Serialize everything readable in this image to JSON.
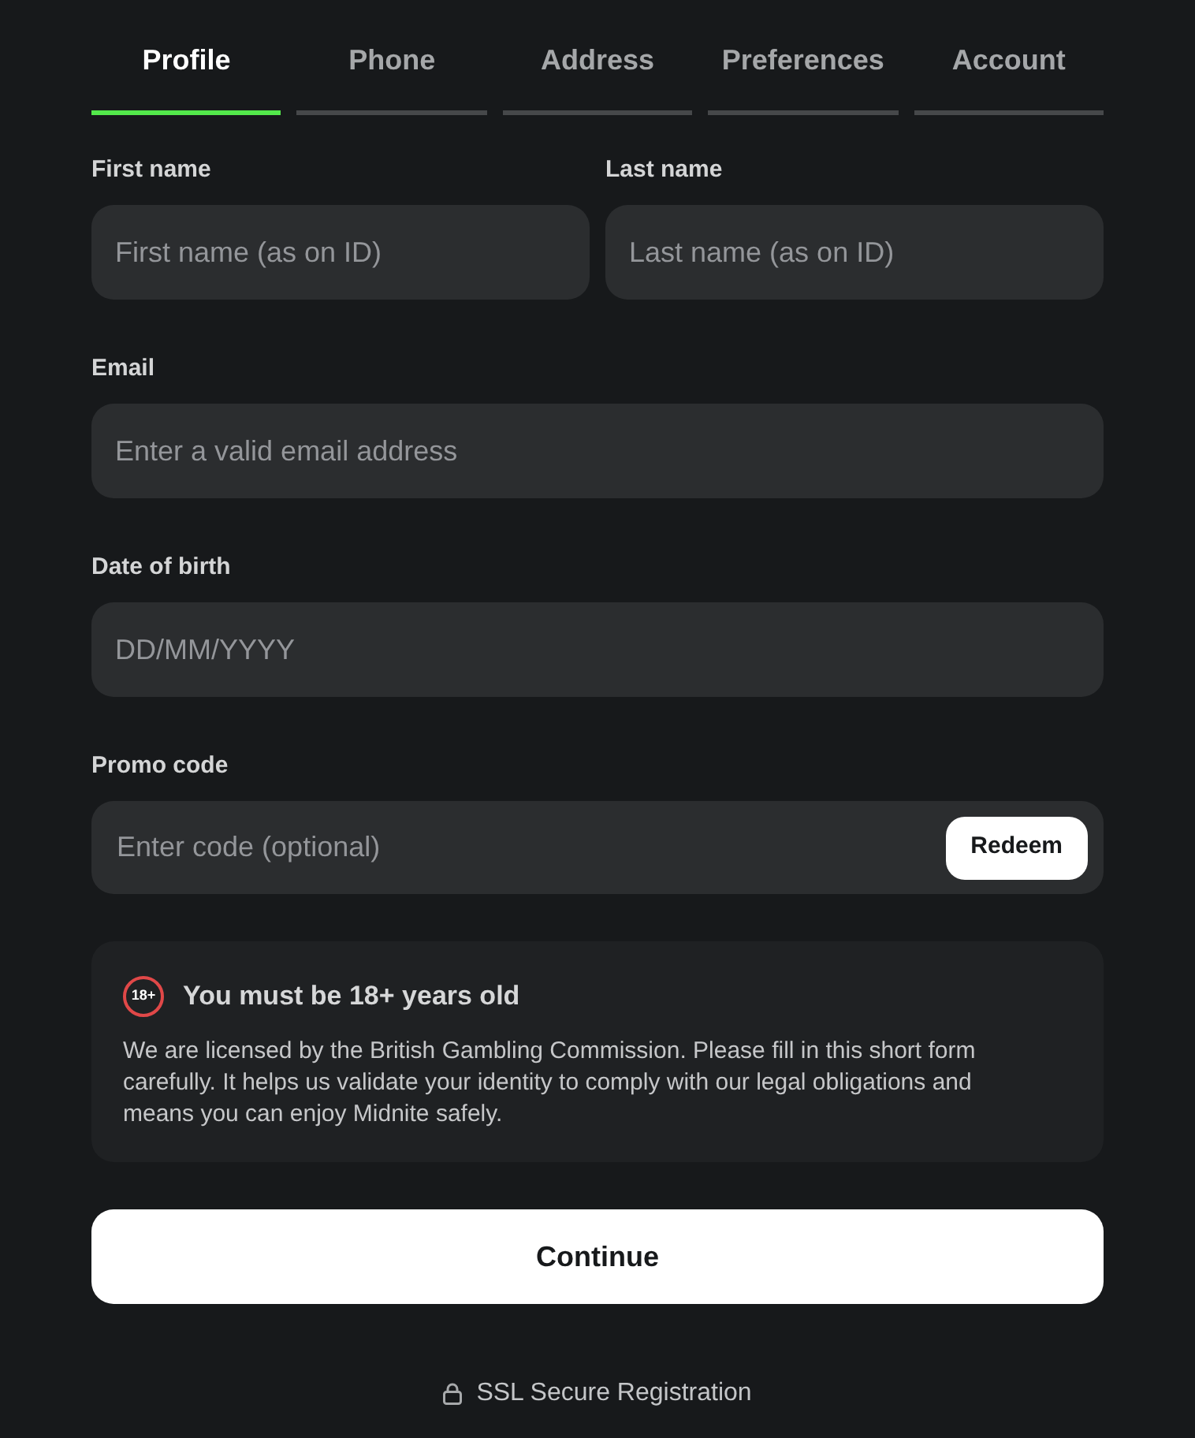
{
  "tabs": [
    {
      "label": "Profile",
      "selected": true
    },
    {
      "label": "Phone",
      "selected": false
    },
    {
      "label": "Address",
      "selected": false
    },
    {
      "label": "Preferences",
      "selected": false
    },
    {
      "label": "Account",
      "selected": false
    }
  ],
  "name_fields": [
    {
      "label": "First name",
      "placeholder": "First name (as on ID)"
    },
    {
      "label": "Last name",
      "placeholder": "Last name (as on ID)"
    }
  ],
  "fields": [
    {
      "label": "Email",
      "placeholder": "Enter a valid email address"
    },
    {
      "label": "Date of birth",
      "placeholder": "DD/MM/YYYY"
    }
  ],
  "promo": {
    "label": "Promo code",
    "placeholder": "Enter code (optional)",
    "button": "Redeem"
  },
  "notice": {
    "badge": "18+",
    "title": "You must be 18+ years old",
    "text": "We are licensed by the British Gambling Commission. Please fill in this short form carefully. It helps us validate your identity to comply with our legal obligations and means you can enjoy Midnite safely."
  },
  "continue_button": "Continue",
  "footer": {
    "text": "SSL Secure Registration"
  }
}
